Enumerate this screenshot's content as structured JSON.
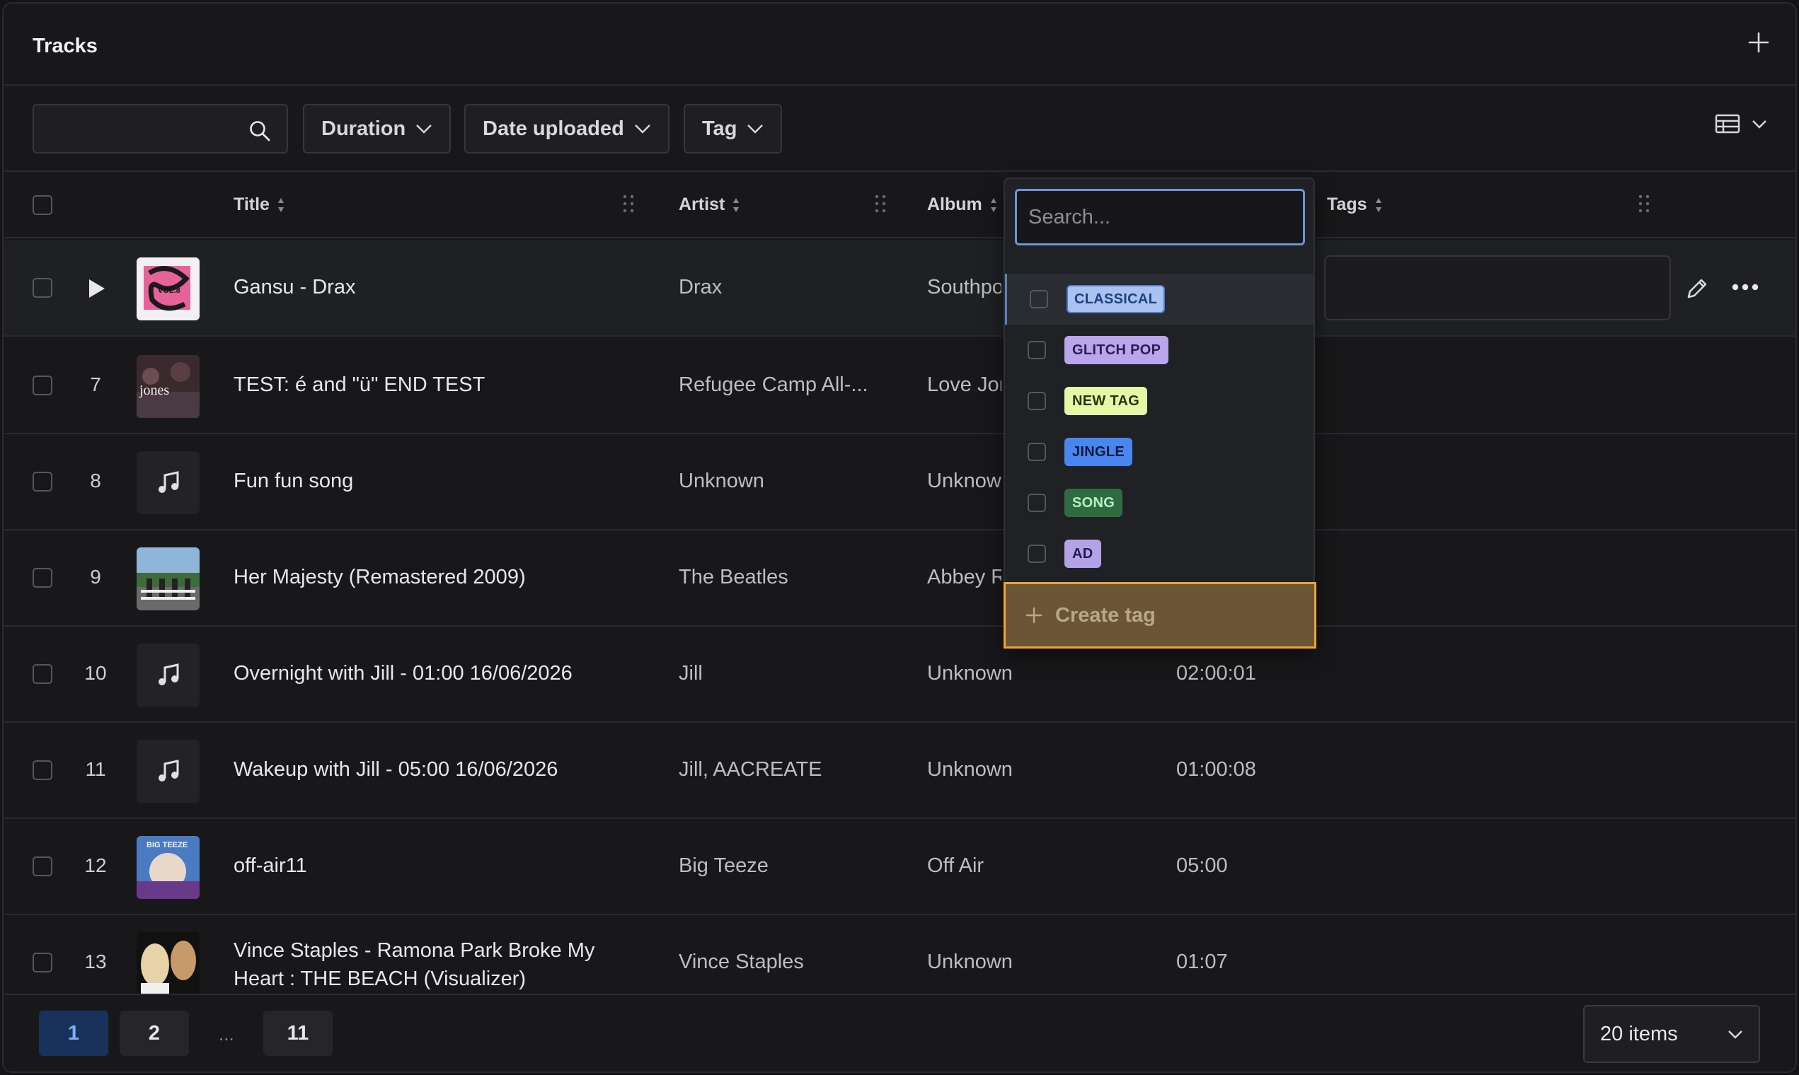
{
  "header": {
    "title": "Tracks",
    "add_icon": "plus-icon"
  },
  "toolbar": {
    "search": {
      "value": "",
      "placeholder": ""
    },
    "filters": [
      "Duration",
      "Date uploaded",
      "Tag"
    ],
    "view_icon": "table-view-icon"
  },
  "columns": {
    "title": "Title",
    "artist": "Artist",
    "album": "Album",
    "tags": "Tags"
  },
  "rows": [
    {
      "num": "",
      "title": "Gansu - Drax",
      "artist": "Drax",
      "album": "Southpo",
      "duration": "",
      "artwork": "album-cover",
      "playing": true
    },
    {
      "num": "7",
      "title": "TEST: é and \"ü\" END TEST",
      "artist": "Refugee Camp All-...",
      "album": "Love Jon",
      "duration": "",
      "artwork": "album-cover"
    },
    {
      "num": "8",
      "title": "Fun fun song",
      "artist": "Unknown",
      "album": "Unknow",
      "duration": "",
      "artwork": "music-note"
    },
    {
      "num": "9",
      "title": "Her Majesty (Remastered 2009)",
      "artist": "The Beatles",
      "album": "Abbey R",
      "duration": "",
      "artwork": "album-cover"
    },
    {
      "num": "10",
      "title": "Overnight with Jill - 01:00 16/06/2026",
      "artist": "Jill",
      "album": "Unknown",
      "duration": "02:00:01",
      "artwork": "music-note"
    },
    {
      "num": "11",
      "title": "Wakeup with Jill - 05:00 16/06/2026",
      "artist": "Jill, AACREATE",
      "album": "Unknown",
      "duration": "01:00:08",
      "artwork": "music-note"
    },
    {
      "num": "12",
      "title": "off-air11",
      "artist": "Big Teeze",
      "album": "Off Air",
      "duration": "05:00",
      "artwork": "album-cover"
    },
    {
      "num": "13",
      "title": "Vince Staples - Ramona Park Broke My Heart : THE BEACH (Visualizer)",
      "artist": "Vince Staples",
      "album": "Unknown",
      "duration": "01:07",
      "artwork": "album-cover"
    }
  ],
  "tag_dropdown": {
    "search_placeholder": "Search...",
    "tags": [
      {
        "label": "CLASSICAL",
        "bg": "#a9c3ee",
        "fg": "#1f3f86",
        "border": "#4d7ad6"
      },
      {
        "label": "GLITCH POP",
        "bg": "#b9a6ec",
        "fg": "#2a1d55"
      },
      {
        "label": "NEW TAG",
        "bg": "#e6f7a6",
        "fg": "#2b3310"
      },
      {
        "label": "JINGLE",
        "bg": "#4a86f0",
        "fg": "#0c1a3a"
      },
      {
        "label": "SONG",
        "bg": "#2f6b40",
        "fg": "#b6f0c4"
      },
      {
        "label": "AD",
        "bg": "#b3a3e6",
        "fg": "#241a4d"
      }
    ],
    "create_label": "Create tag"
  },
  "pagination": {
    "pages": [
      "1",
      "2",
      "...",
      "11"
    ],
    "active": "1",
    "per_page": "20 items"
  }
}
